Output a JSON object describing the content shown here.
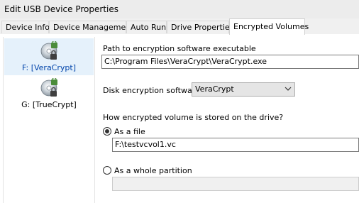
{
  "window": {
    "title": "Edit USB Device Properties"
  },
  "tabs": [
    {
      "label": "Device Info"
    },
    {
      "label": "Device Management"
    },
    {
      "label": "Auto Run"
    },
    {
      "label": "Drive Properties"
    },
    {
      "label": "Encrypted Volumes"
    }
  ],
  "active_tab": "Encrypted Volumes",
  "drives": [
    {
      "label": "F: [VeraCrypt]",
      "selected": true,
      "icon": "encrypted-disk-icon"
    },
    {
      "label": "G: [TrueCrypt]",
      "selected": false,
      "icon": "encrypted-disk-icon"
    }
  ],
  "form": {
    "path_label": "Path to encryption software executable",
    "path_value": "C:\\Program Files\\VeraCrypt\\VeraCrypt.exe",
    "software_label": "Disk encryption software",
    "software_value": "VeraCrypt",
    "storage_label": "How encrypted volume is stored on the drive?",
    "as_file_label": "As a file",
    "file_value": "F:\\testvcvol1.vc",
    "as_partition_label": "As a whole partition",
    "storage_selected": "As a file"
  },
  "colors": {
    "selection": "#e5f1fb",
    "selected_text": "#0044aa"
  }
}
